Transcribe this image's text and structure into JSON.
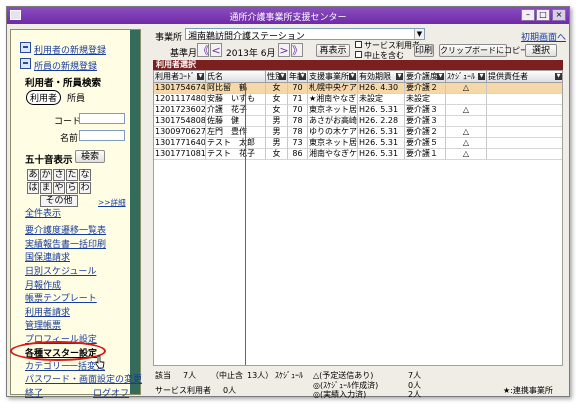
{
  "window": {
    "title": "通所介護事業所支援センター",
    "min": "–",
    "max": "□",
    "close": "×"
  },
  "sidebar": {
    "new_user": "利用者の新規登録",
    "new_office": "所員の新規登録",
    "search_title": "利用者・所員検索",
    "radio_user": "利用者",
    "radio_staff": "所員",
    "code_label": "コード",
    "name_label": "名前",
    "kana_title": "五十音表示",
    "search_button": "検索",
    "kana": [
      "あ",
      "か",
      "さ",
      "た",
      "な",
      "は",
      "ま",
      "や",
      "ら",
      "わ"
    ],
    "kana_other": "その他",
    "detail": ">>詳細",
    "show_all": "全件表示",
    "links": [
      "要介護度遷移一覧表",
      "実績報告書一括印刷",
      "国保連請求",
      "日別スケジュール",
      "月報作成",
      "帳票テンプレート",
      "利用者請求",
      "管理帳票",
      "プロフィール設定",
      "各種マスター設定",
      "カテゴリー",
      "パスワード・画面設定の変更"
    ],
    "hidden_link": "一括変更",
    "end": "終了",
    "logout": "ログオフ"
  },
  "top": {
    "office_label": "事業所",
    "office_value": "湘南鵜訪問介護ステーション",
    "initial_screen": "初期画面へ",
    "base_month_label": "基準月",
    "prev_year": "《",
    "prev_month": "<",
    "month_value": "2013年 6月",
    "next_month": ">",
    "next_year": "》",
    "redisplay": "再表示",
    "chk_service_user": "サービス利用者",
    "chk_include_stopped": "中止を含む",
    "print": "印刷",
    "copy_clipboard": "クリップボードにコピー",
    "select": "選択"
  },
  "list": {
    "heading": "利用者選択",
    "columns": [
      "利用者ｺｰﾄﾞ",
      "氏名",
      "性別",
      "年齢",
      "支援事業所名",
      "有効期限",
      "要介護度",
      "ｽｹｼﾞｭｰﾙ",
      "提供責任者"
    ],
    "rows": [
      [
        "1301754674",
        "阿比留　鶴",
        "女",
        "70",
        "札幌中央ケア",
        "H26. 4.30",
        "要介護２",
        "△",
        ""
      ],
      [
        "1201117480",
        "安藤　いずも",
        "女",
        "71",
        "★湘南やなぎ",
        "未設定",
        "未設定",
        "",
        ""
      ],
      [
        "1201723602",
        "介護　花子",
        "女",
        "70",
        "東京ネット居宅",
        "H26. 5.31",
        "要介護３",
        "△",
        ""
      ],
      [
        "1301754808",
        "佐藤　健",
        "男",
        "78",
        "あさがお高崎",
        "H26. 2.28",
        "要介護３",
        "",
        ""
      ],
      [
        "1300970627",
        "左門　豊作",
        "男",
        "78",
        "ゆりの木ケア",
        "H26. 5.31",
        "要介護２",
        "△",
        ""
      ],
      [
        "1301771640",
        "テスト　太郎",
        "男",
        "73",
        "東京ネット居宅",
        "H26. 5.31",
        "要介護５",
        "△",
        ""
      ],
      [
        "1301771081",
        "テスト　花子",
        "女",
        "86",
        "湘南やなぎケア",
        "H26. 5.31",
        "要介護１",
        "△",
        ""
      ]
    ]
  },
  "status": {
    "count_label": "該当",
    "count_value": "7人",
    "stopped": "（中止含",
    "stopped_value": "13人）",
    "schedule_label": "ｽｹｼﾞｭｰﾙ",
    "sched1": "△(予定送信あり)",
    "sched1_v": "7人",
    "sched2": "◎(ｽｹｼﾞｭｰﾙ作成済)",
    "sched2_v": "0人",
    "sched3": "◎(実績入力済)",
    "sched3_v": "2人",
    "service_mgr": "サービス利用者",
    "service_mgr_v": "0人",
    "legend": "★:連携事業所"
  }
}
